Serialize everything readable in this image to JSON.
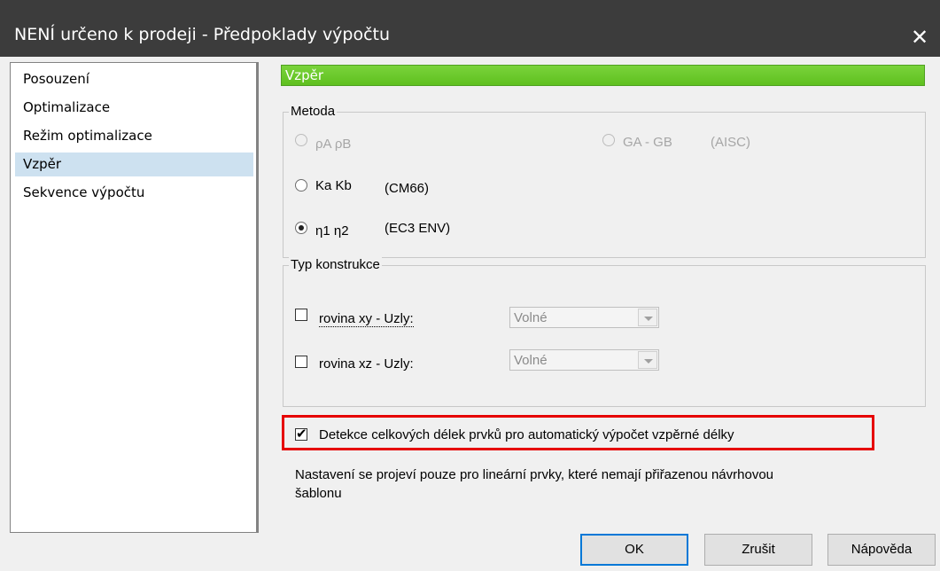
{
  "window": {
    "title": "NENÍ určeno k prodeji - Předpoklady výpočtu",
    "close_glyph": "✕"
  },
  "nav": {
    "items": [
      {
        "label": "Posouzení"
      },
      {
        "label": "Optimalizace"
      },
      {
        "label": "Režim optimalizace"
      },
      {
        "label": "Vzpěr"
      },
      {
        "label": "Sekvence výpočtu"
      }
    ],
    "selected": "Vzpěr"
  },
  "section": {
    "header": "Vzpěr",
    "header_color": "#6cc92c"
  },
  "method": {
    "legend": "Metoda",
    "options": {
      "pa_pb": {
        "label": "ρA ρB",
        "selected": false,
        "enabled": false
      },
      "ga_gb": {
        "label": "GA - GB",
        "note": "(AISC)",
        "selected": false,
        "enabled": false
      },
      "ka_kb": {
        "label": "Ka Kb",
        "note": "(CM66)",
        "selected": false,
        "enabled": true
      },
      "eta": {
        "label": "η1 η2",
        "note": "(EC3 ENV)",
        "selected": true,
        "enabled": true
      }
    }
  },
  "construction": {
    "legend": "Typ konstrukce",
    "rows": [
      {
        "label": "rovina xy - Uzly:",
        "checked": false,
        "value": "Volné"
      },
      {
        "label": "rovina xz - Uzly:",
        "checked": false,
        "value": "Volné"
      }
    ]
  },
  "detection": {
    "label": "Detekce celkových délek prvků pro automatický výpočet vzpěrné délky",
    "checked": true,
    "check_glyph": "✔",
    "highlight_color": "#e60000"
  },
  "note": {
    "line1": "Nastavení se projeví pouze pro lineární prvky, které nemají přiřazenou návrhovou",
    "line2": "šablonu"
  },
  "buttons": {
    "ok": "OK",
    "cancel": "Zrušit",
    "help": "Nápověda"
  }
}
